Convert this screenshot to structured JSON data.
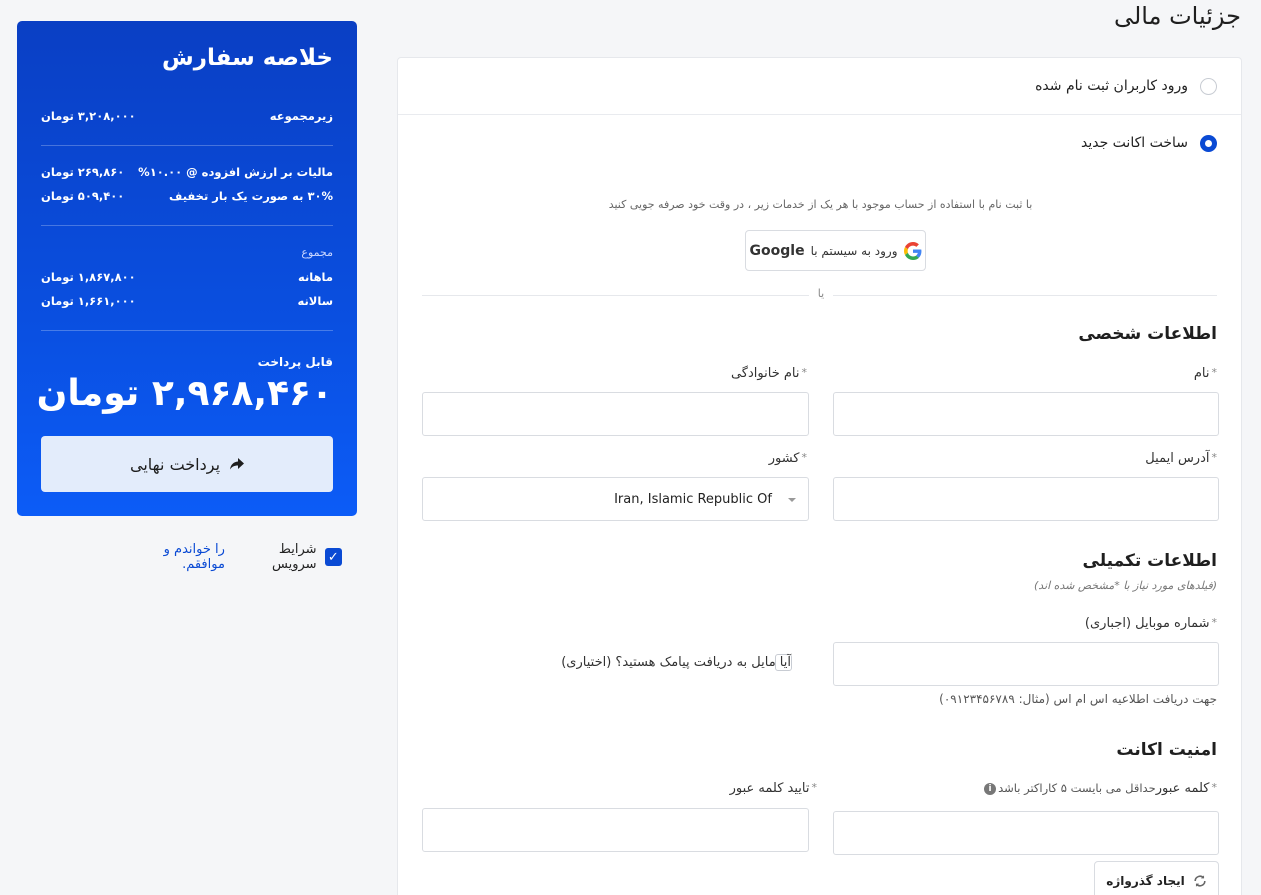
{
  "page": {
    "title": "جزئیات مالی"
  },
  "login_options": {
    "existing": "ورود کاربران ثبت نام شده",
    "new_account": "ساخت اکانت جدید",
    "selected": "new_account"
  },
  "social": {
    "hint": "با ثبت نام با استفاده از حساب موجود با هر یک از خدمات زیر ، در وقت خود صرفه جویی کنید",
    "google_prefix": "ورود به سیستم با",
    "google_word": "Google",
    "or": "یا"
  },
  "personal": {
    "title": "اطلاعات شخصی",
    "first_name_label": "نام",
    "last_name_label": "نام خانوادگی",
    "email_label": "آدرس ایمیل",
    "country_label": "کشور",
    "country_value": "Iran, Islamic Republic Of"
  },
  "extra": {
    "title": "اطلاعات تکمیلی",
    "subtitle": "(فیلدهای مورد نیاز با *مشخص شده اند)",
    "mobile_label": "شماره موبایل (اجباری)",
    "mobile_hint": "جهت دریافت اطلاعیه اس ام اس (مثال: ۰۹۱۲۳۴۵۶۷۸۹)",
    "sms_optin": "آیا مایل به دریافت پیامک هستید؟ (اختیاری)"
  },
  "security": {
    "title": "امنیت اکانت",
    "password_label": "کلمه عبور",
    "password_hint": "حداقل می بایست ۵ کاراکتر باشد",
    "confirm_label": "تایید کلمه عبور",
    "generate_label": "ایجاد گذرواژه"
  },
  "summary": {
    "title": "خلاصه سفارش",
    "subtotal_label": "زیرمجموعه",
    "subtotal_value": "۳,۲۰۸,۰۰۰ تومان",
    "tax_label": "مالیات بر ارزش افزوده @ ۱۰.۰۰%",
    "tax_value": "۲۶۹,۸۶۰ تومان",
    "discount_label": "۳۰% به صورت یک بار تخفیف",
    "discount_value": "۵۰۹,۴۰۰ تومان",
    "total_heading": "مجموع",
    "monthly_label": "ماهانه",
    "monthly_value": "۱,۸۶۷,۸۰۰ تومان",
    "yearly_label": "سالانه",
    "yearly_value": "۱,۶۶۱,۰۰۰ تومان",
    "payable_label": "قابل پرداخت",
    "payable_value": "۲,۹۶۸,۴۶۰ تومان",
    "checkout_label": "پرداخت نهایی"
  },
  "terms": {
    "prefix": "شرایط سرویس",
    "link": "را خواندم و موافقم.",
    "checked": true
  },
  "colors": {
    "accent": "#0a4ad4",
    "panel_top": "#0a3fc4",
    "panel_bottom": "#0c5cf7"
  }
}
